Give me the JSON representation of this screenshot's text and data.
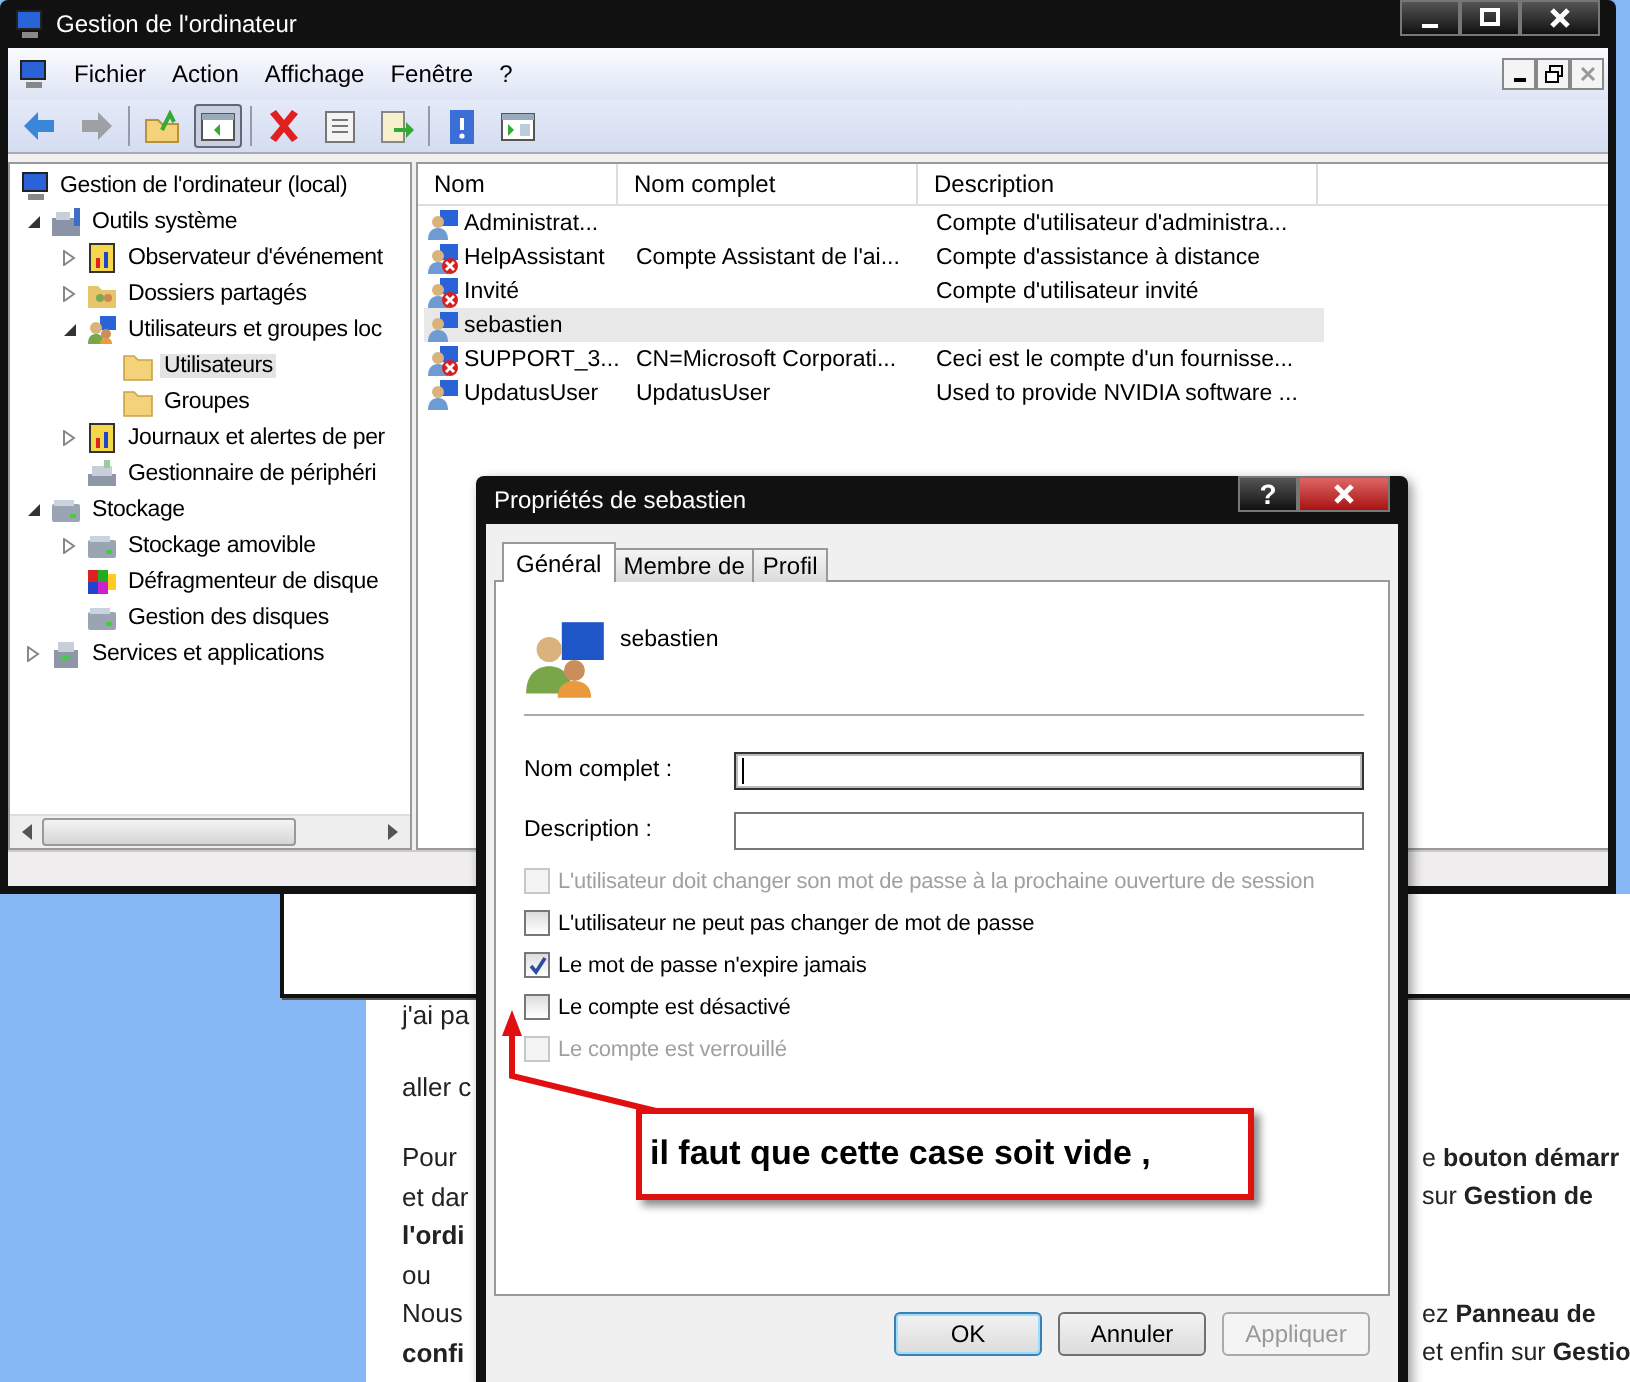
{
  "main_window": {
    "title": "Gestion de l'ordinateur",
    "menu": [
      "Fichier",
      "Action",
      "Affichage",
      "Fenêtre",
      "?"
    ],
    "toolbar": [
      {
        "disabled": false,
        "pressed": false
      },
      {
        "disabled": true,
        "pressed": false
      },
      {
        "disabled": false,
        "pressed": false
      },
      {
        "disabled": false,
        "pressed": true
      },
      {
        "disabled": false,
        "pressed": false
      },
      {
        "disabled": false,
        "pressed": false
      },
      {
        "disabled": false,
        "pressed": false
      },
      {
        "disabled": false,
        "pressed": false
      },
      {
        "disabled": false,
        "pressed": false
      }
    ],
    "tree": [
      {
        "label": "Gestion de l'ordinateur (local)",
        "selected": false,
        "children": [
          {
            "label": "Outils système",
            "selected": false,
            "expanded": true,
            "children": [
              {
                "label": "Observateur d'événement",
                "selected": false,
                "expanded": false
              },
              {
                "label": "Dossiers partagés",
                "selected": false,
                "expanded": false
              },
              {
                "label": "Utilisateurs et groupes loc",
                "selected": false,
                "expanded": true,
                "children": [
                  {
                    "label": "Utilisateurs",
                    "selected": true
                  },
                  {
                    "label": "Groupes",
                    "selected": false
                  }
                ]
              },
              {
                "label": "Journaux et alertes de per",
                "selected": false,
                "expanded": false
              },
              {
                "label": "Gestionnaire de périphéri",
                "selected": false
              }
            ]
          },
          {
            "label": "Stockage",
            "selected": false,
            "expanded": true,
            "children": [
              {
                "label": "Stockage amovible",
                "selected": false,
                "expanded": false
              },
              {
                "label": "Défragmenteur de disque",
                "selected": false
              },
              {
                "label": "Gestion des disques",
                "selected": false
              }
            ]
          },
          {
            "label": "Services et applications",
            "selected": false,
            "expanded": false
          }
        ]
      }
    ],
    "list": {
      "columns": [
        "Nom",
        "Nom complet",
        "Description"
      ],
      "rows": [
        {
          "name": "Administrat...",
          "description": "Compte d'utilisateur d'administra...",
          "disabled": false,
          "selected": false
        },
        {
          "name": "HelpAssistant",
          "full_name": "Compte Assistant de l'ai...",
          "description": "Compte d'assistance à distance",
          "disabled": true,
          "selected": false
        },
        {
          "name": "Invité",
          "description": "Compte d'utilisateur invité",
          "disabled": true,
          "selected": false
        },
        {
          "name": "sebastien",
          "disabled": false,
          "selected": true
        },
        {
          "name": "SUPPORT_3...",
          "full_name": "CN=Microsoft Corporati...",
          "description": "Ceci est le compte d'un fournisse...",
          "disabled": true,
          "selected": false
        },
        {
          "name": "UpdatusUser",
          "full_name": "UpdatusUser",
          "description": "Used to provide NVIDIA software ...",
          "disabled": false,
          "selected": false
        }
      ]
    }
  },
  "background_page": {
    "paragraphs": [
      [
        {
          "left": {
            "text": "j'ai pa",
            "bold": false
          }
        }
      ],
      [
        {
          "left": {
            "text": "aller c",
            "bold": false
          }
        }
      ],
      [
        {
          "left": {
            "text": "Pour",
            "bold": false
          },
          "right": {
            "text": "e **bouton démarr**",
            "bold": false
          }
        },
        {
          "left": {
            "text": "et dar",
            "bold": false
          },
          "right": {
            "text": "sur **Gestion de**",
            "bold": false
          }
        },
        {
          "left": {
            "text": "l'ordi",
            "bold": true
          }
        },
        {
          "left": {
            "text": "ou",
            "bold": false
          }
        },
        {
          "left": {
            "text": "Nous",
            "bold": false
          },
          "right": {
            "text": "ez **Panneau de**",
            "bold": false
          }
        },
        {
          "left": {
            "text": "confi",
            "bold": true
          },
          "right": {
            "text": "et enfin sur **Gestio**",
            "bold": false
          }
        }
      ]
    ]
  },
  "dialog": {
    "title": "Propriétés de sebastien",
    "help_button": "?",
    "tabs": [
      {
        "label": "Général",
        "selected": true
      },
      {
        "label": "Membre de",
        "selected": false
      },
      {
        "label": "Profil",
        "selected": false
      }
    ],
    "user_name": "sebastien",
    "fields": [
      {
        "label": "Nom complet :",
        "focused": true
      },
      {
        "label": "Description :",
        "focused": false
      }
    ],
    "checkboxes": [
      {
        "label": "L'utilisateur doit changer son mot de passe à la prochaine ouverture de session",
        "checked": false,
        "disabled": true
      },
      {
        "label": "L'utilisateur ne peut pas changer de mot de passe",
        "checked": false,
        "disabled": false
      },
      {
        "label": "Le mot de passe n'expire jamais",
        "checked": true,
        "disabled": false
      },
      {
        "label": "Le compte est désactivé",
        "checked": false,
        "disabled": false
      },
      {
        "label": "Le compte est verrouillé",
        "checked": false,
        "disabled": true
      }
    ],
    "buttons": [
      {
        "label": "OK",
        "default": true,
        "disabled": false
      },
      {
        "label": "Annuler",
        "default": false,
        "disabled": false
      },
      {
        "label": "Appliquer",
        "default": false,
        "disabled": true
      }
    ]
  },
  "annotation": {
    "text": "il faut que cette case soit vide ,"
  }
}
